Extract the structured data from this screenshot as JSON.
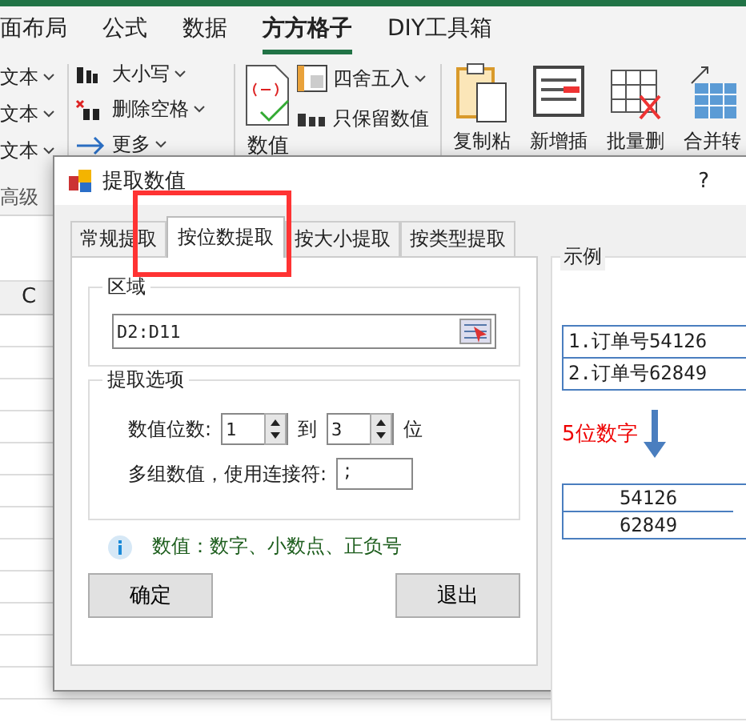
{
  "ribbon": {
    "tabs": [
      {
        "label": "面布局",
        "selected": false
      },
      {
        "label": "公式",
        "selected": false
      },
      {
        "label": "数据",
        "selected": false
      },
      {
        "label": "方方格子",
        "selected": true
      },
      {
        "label": "DIY工具箱",
        "selected": false
      }
    ],
    "text_menus": [
      "文本",
      "文本",
      "文本"
    ],
    "group_label": "高级",
    "small_commands": [
      {
        "kind": "case",
        "label": "大小写"
      },
      {
        "kind": "trim",
        "label": "删除空格"
      },
      {
        "kind": "more",
        "label": "更多"
      }
    ],
    "value_button": "数值",
    "number_commands": [
      {
        "kind": "round",
        "label": "四舍五入"
      },
      {
        "kind": "keep",
        "label": "只保留数值"
      }
    ],
    "big_buttons": [
      {
        "kind": "paste",
        "label": "复制粘"
      },
      {
        "kind": "insert",
        "label": "新增插"
      },
      {
        "kind": "delete",
        "label": "批量删"
      },
      {
        "kind": "merge",
        "label": "合并转"
      }
    ]
  },
  "sheet": {
    "column_header": "C"
  },
  "dialog": {
    "title": "提取数值",
    "help": "?",
    "tabs": [
      {
        "label": "常规提取",
        "selected": false
      },
      {
        "label": "按位数提取",
        "selected": true
      },
      {
        "label": "按大小提取",
        "selected": false
      },
      {
        "label": "按类型提取",
        "selected": false
      }
    ],
    "region": {
      "legend": "区域",
      "value": "D2:D11"
    },
    "options": {
      "legend": "提取选项",
      "digits_label": "数值位数:",
      "from": "1",
      "to_label": "到",
      "to": "3",
      "unit": "位",
      "joiner_label": "多组数值，使用连接符:",
      "joiner": ";"
    },
    "info": "数值：数字、小数点、正负号",
    "ok": "确定",
    "cancel": "退出",
    "example": {
      "legend": "示例",
      "source_rows": [
        "1.订单号54126",
        "2.订单号62849"
      ],
      "note": "5位数字",
      "result_rows": [
        "54126",
        "62849"
      ]
    }
  }
}
